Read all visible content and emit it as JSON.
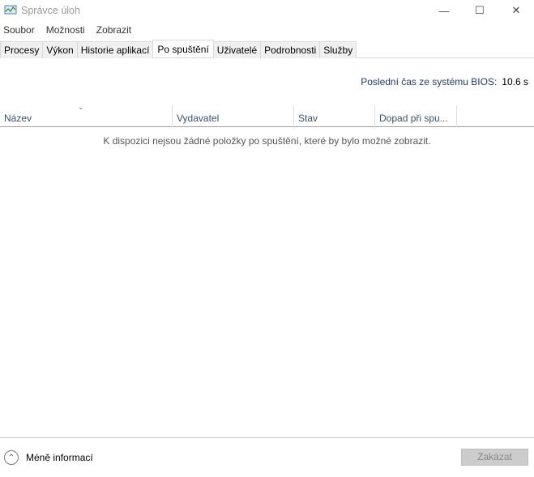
{
  "window": {
    "title": "Správce úloh",
    "minimize": "—",
    "maximize": "☐",
    "close": "✕"
  },
  "menu": [
    "Soubor",
    "Možnosti",
    "Zobrazit"
  ],
  "tabs": [
    "Procesy",
    "Výkon",
    "Historie aplikací",
    "Po spuštění",
    "Uživatelé",
    "Podrobnosti",
    "Služby"
  ],
  "bios": {
    "label": "Poslední čas ze systému BIOS:",
    "value": "10.6 s"
  },
  "columns": [
    "Název",
    "Vydavatel",
    "Stav",
    "Dopad při spu..."
  ],
  "empty_message": "K dispozici nejsou žádné položky po spuštění, které by bylo možné zobrazit.",
  "footer": {
    "less_info": "Méně informací",
    "disable": "Zakázat"
  }
}
